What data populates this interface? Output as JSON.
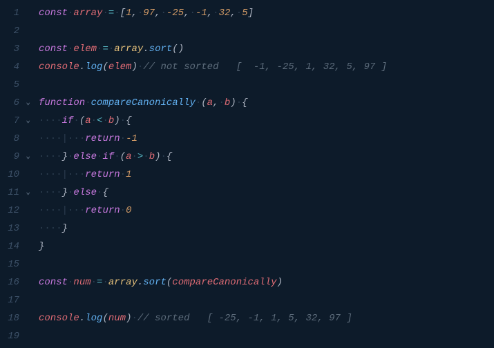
{
  "lines": {
    "n1": "1",
    "n2": "2",
    "n3": "3",
    "n4": "4",
    "n5": "5",
    "n6": "6",
    "n7": "7",
    "n8": "8",
    "n9": "9",
    "n10": "10",
    "n11": "11",
    "n12": "12",
    "n13": "13",
    "n14": "14",
    "n15": "15",
    "n16": "16",
    "n17": "17",
    "n18": "18",
    "n19": "19"
  },
  "tokens": {
    "const": "const",
    "array": "array",
    "eq": "=",
    "lbrack": "[",
    "rbrack": "]",
    "v1": "1",
    "v97": "97",
    "vm25": "-25",
    "vm1": "-1",
    "v32": "32",
    "v5": "5",
    "comma": ",",
    "sp": " ",
    "elem": "elem",
    "dot": ".",
    "sort": "sort",
    "lp": "(",
    "rp": ")",
    "console": "console",
    "log": "log",
    "c_notsorted": "// not sorted   [  -1, -25, 1, 32, 5, 97 ]",
    "function": "function",
    "compareCanonically": "compareCanonically",
    "a": "a",
    "b": "b",
    "lb": "{",
    "rb": "}",
    "if": "if",
    "else": "else",
    "lt": "<",
    "gt": ">",
    "return": "return",
    "m1": "-1",
    "p1": "1",
    "z": "0",
    "num": "num",
    "c_sorted": "// sorted   [ -25, -1, 1, 5, 32, 97 ]",
    "dots": "····",
    "dots2": "····",
    "pipe": "|"
  }
}
